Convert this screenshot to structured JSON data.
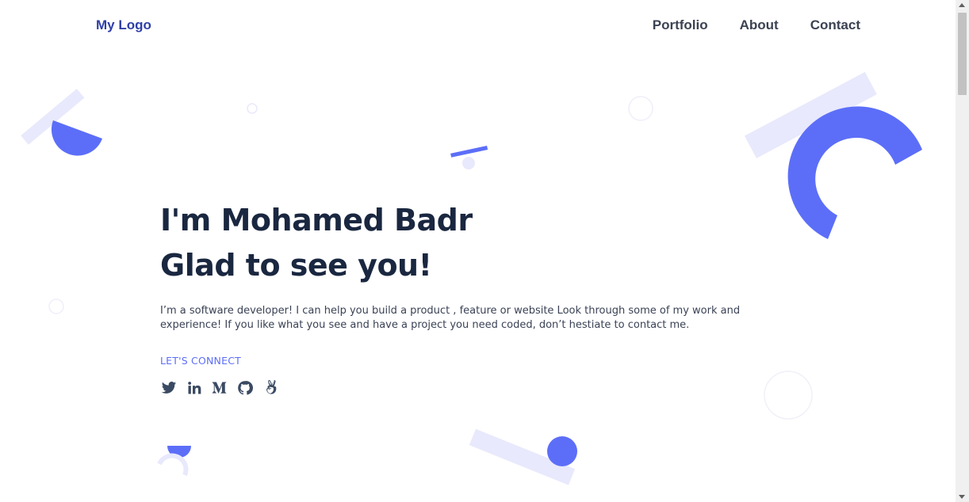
{
  "header": {
    "logo": "My Logo",
    "nav": [
      "Portfolio",
      "About",
      "Contact"
    ]
  },
  "hero": {
    "title_line1": "I'm Mohamed Badr",
    "title_line2": "Glad to see you!",
    "description": "I’m a software developer! I can help you build a product , feature or website Look through some of my work and experience! If you like what you see and have a project you need coded, don’t hestiate to contact me.",
    "connect_label": "LET'S CONNECT",
    "socials": [
      "twitter-icon",
      "linkedin-icon",
      "medium-icon",
      "github-icon",
      "angellist-icon"
    ]
  },
  "colors": {
    "accent": "#5c6ef8",
    "accent_light": "#e8e9fc",
    "heading": "#1a2740",
    "logo": "#2f3fa8"
  }
}
